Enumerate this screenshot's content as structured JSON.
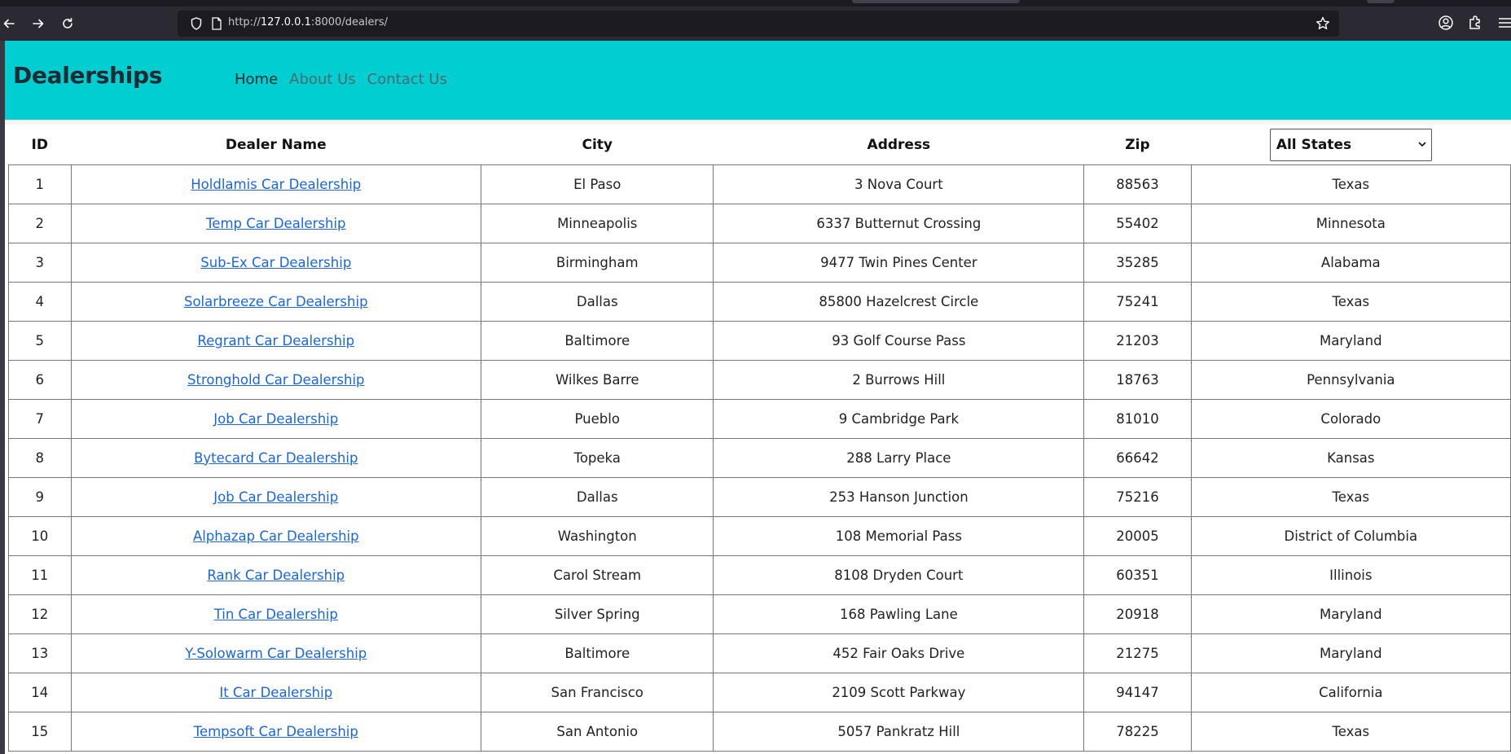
{
  "browser": {
    "url_prefix": "http://",
    "url_host": "127.0.0.1",
    "url_rest": ":8000/dealers/"
  },
  "navbar": {
    "brand": "Dealerships",
    "links": [
      "Home",
      "About Us",
      "Contact Us"
    ],
    "bg_color": "#00ced1"
  },
  "table": {
    "headers": {
      "id": "ID",
      "name": "Dealer Name",
      "city": "City",
      "address": "Address",
      "zip": "Zip"
    },
    "state_filter": {
      "selected": "All States"
    },
    "rows": [
      {
        "id": "1",
        "name": "Holdlamis Car Dealership",
        "city": "El Paso",
        "address": "3 Nova Court",
        "zip": "88563",
        "state": "Texas"
      },
      {
        "id": "2",
        "name": "Temp Car Dealership",
        "city": "Minneapolis",
        "address": "6337 Butternut Crossing",
        "zip": "55402",
        "state": "Minnesota"
      },
      {
        "id": "3",
        "name": "Sub-Ex Car Dealership",
        "city": "Birmingham",
        "address": "9477 Twin Pines Center",
        "zip": "35285",
        "state": "Alabama"
      },
      {
        "id": "4",
        "name": "Solarbreeze Car Dealership",
        "city": "Dallas",
        "address": "85800 Hazelcrest Circle",
        "zip": "75241",
        "state": "Texas"
      },
      {
        "id": "5",
        "name": "Regrant Car Dealership",
        "city": "Baltimore",
        "address": "93 Golf Course Pass",
        "zip": "21203",
        "state": "Maryland"
      },
      {
        "id": "6",
        "name": "Stronghold Car Dealership",
        "city": "Wilkes Barre",
        "address": "2 Burrows Hill",
        "zip": "18763",
        "state": "Pennsylvania"
      },
      {
        "id": "7",
        "name": "Job Car Dealership",
        "city": "Pueblo",
        "address": "9 Cambridge Park",
        "zip": "81010",
        "state": "Colorado"
      },
      {
        "id": "8",
        "name": "Bytecard Car Dealership",
        "city": "Topeka",
        "address": "288 Larry Place",
        "zip": "66642",
        "state": "Kansas"
      },
      {
        "id": "9",
        "name": "Job Car Dealership",
        "city": "Dallas",
        "address": "253 Hanson Junction",
        "zip": "75216",
        "state": "Texas"
      },
      {
        "id": "10",
        "name": "Alphazap Car Dealership",
        "city": "Washington",
        "address": "108 Memorial Pass",
        "zip": "20005",
        "state": "District of Columbia"
      },
      {
        "id": "11",
        "name": "Rank Car Dealership",
        "city": "Carol Stream",
        "address": "8108 Dryden Court",
        "zip": "60351",
        "state": "Illinois"
      },
      {
        "id": "12",
        "name": "Tin Car Dealership",
        "city": "Silver Spring",
        "address": "168 Pawling Lane",
        "zip": "20918",
        "state": "Maryland"
      },
      {
        "id": "13",
        "name": "Y-Solowarm Car Dealership",
        "city": "Baltimore",
        "address": "452 Fair Oaks Drive",
        "zip": "21275",
        "state": "Maryland"
      },
      {
        "id": "14",
        "name": "It Car Dealership",
        "city": "San Francisco",
        "address": "2109 Scott Parkway",
        "zip": "94147",
        "state": "California"
      },
      {
        "id": "15",
        "name": "Tempsoft Car Dealership",
        "city": "San Antonio",
        "address": "5057 Pankratz Hill",
        "zip": "78225",
        "state": "Texas"
      }
    ]
  }
}
